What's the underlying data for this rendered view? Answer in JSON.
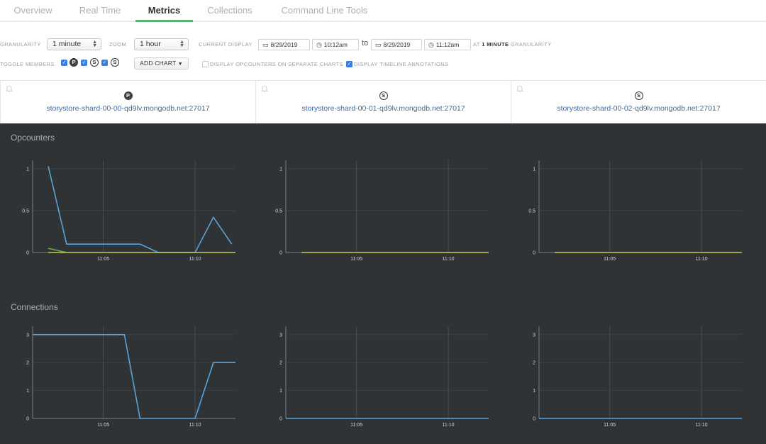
{
  "tabs": [
    {
      "label": "Overview",
      "active": false
    },
    {
      "label": "Real Time",
      "active": false
    },
    {
      "label": "Metrics",
      "active": true
    },
    {
      "label": "Collections",
      "active": false
    },
    {
      "label": "Command Line Tools",
      "active": false
    }
  ],
  "controls": {
    "granularity_label": "GRANULARITY",
    "granularity_value": "1 minute",
    "zoom_label": "ZOOM",
    "zoom_value": "1 hour",
    "current_display_label": "CURRENT DISPLAY",
    "start_date": "8/29/2019",
    "start_time": "10:12am",
    "to_label": "to",
    "end_date": "8/29/2019",
    "end_time": "11:12am",
    "at_label": "AT",
    "granularity_bold": "1 MINUTE",
    "granularity_suffix": "GRANULARITY",
    "toggle_members_label": "TOGGLE MEMBERS",
    "members": [
      {
        "role": "P",
        "checked": true
      },
      {
        "role": "S",
        "checked": true
      },
      {
        "role": "S",
        "checked": true
      }
    ],
    "add_chart_label": "ADD CHART",
    "separate_charts_label": "DISPLAY OPCOUNTERS ON SEPARATE CHARTS",
    "separate_charts_checked": false,
    "timeline_annotations_label": "DISPLAY TIMELINE ANNOTATIONS",
    "timeline_annotations_checked": true
  },
  "hosts": [
    {
      "role": "P",
      "name": "storystore-shard-00-00-qd9lv.mongodb.net:27017"
    },
    {
      "role": "S",
      "name": "storystore-shard-00-01-qd9lv.mongodb.net:27017"
    },
    {
      "role": "S",
      "name": "storystore-shard-00-02-qd9lv.mongodb.net:27017"
    }
  ],
  "colors": {
    "series_blue": "#5ba3d9",
    "series_green": "#6ab04c",
    "series_yellow": "#c5c94a",
    "accent_tab": "#5aae6c",
    "link": "#3a6da6"
  },
  "chart_data": [
    {
      "section": "Opcounters",
      "type": "line",
      "host": "storystore-shard-00-00-qd9lv.mongodb.net:27017",
      "xlim": [
        1.15,
        12.2
      ],
      "ylim": [
        0,
        1.1
      ],
      "xticks": [
        {
          "v": 5,
          "label": "11:05"
        },
        {
          "v": 10,
          "label": "11:10"
        }
      ],
      "yticks": [
        {
          "v": 0,
          "label": "0"
        },
        {
          "v": 0.5,
          "label": "0.5"
        },
        {
          "v": 1,
          "label": "1"
        }
      ],
      "series": [
        {
          "name": "opcounter-blue",
          "color": "#5ba3d9",
          "x": [
            2,
            3,
            4,
            5,
            6,
            7,
            8,
            9,
            10,
            11,
            12
          ],
          "values": [
            1.03,
            0.1,
            0.1,
            0.1,
            0.1,
            0.1,
            0,
            0,
            0,
            0.42,
            0.1
          ]
        },
        {
          "name": "opcounter-green",
          "color": "#6ab04c",
          "x": [
            2,
            3
          ],
          "values": [
            0.05,
            0
          ]
        },
        {
          "name": "opcounter-yellow",
          "color": "#c5c94a",
          "x": [
            2,
            12.2
          ],
          "values": [
            0,
            0
          ]
        }
      ]
    },
    {
      "section": "Opcounters",
      "type": "line",
      "host": "storystore-shard-00-01-qd9lv.mongodb.net:27017",
      "xlim": [
        1.15,
        12.2
      ],
      "ylim": [
        0,
        1.1
      ],
      "xticks": [
        {
          "v": 5,
          "label": "11:05"
        },
        {
          "v": 10,
          "label": "11:10"
        }
      ],
      "yticks": [
        {
          "v": 0,
          "label": "0"
        },
        {
          "v": 0.5,
          "label": "0.5"
        },
        {
          "v": 1,
          "label": "1"
        }
      ],
      "series": [
        {
          "name": "opcounter-yellow",
          "color": "#c5c94a",
          "x": [
            2,
            12.2
          ],
          "values": [
            0,
            0
          ]
        }
      ]
    },
    {
      "section": "Opcounters",
      "type": "line",
      "host": "storystore-shard-00-02-qd9lv.mongodb.net:27017",
      "xlim": [
        1.15,
        12.2
      ],
      "ylim": [
        0,
        1.1
      ],
      "xticks": [
        {
          "v": 5,
          "label": "11:05"
        },
        {
          "v": 10,
          "label": "11:10"
        }
      ],
      "yticks": [
        {
          "v": 0,
          "label": "0"
        },
        {
          "v": 0.5,
          "label": "0.5"
        },
        {
          "v": 1,
          "label": "1"
        }
      ],
      "series": [
        {
          "name": "opcounter-yellow",
          "color": "#c5c94a",
          "x": [
            2,
            12.2
          ],
          "values": [
            0,
            0
          ]
        }
      ]
    },
    {
      "section": "Connections",
      "type": "line",
      "host": "storystore-shard-00-00-qd9lv.mongodb.net:27017",
      "xlim": [
        1.15,
        12.2
      ],
      "ylim": [
        0,
        3.3
      ],
      "xticks": [
        {
          "v": 5,
          "label": "11:05"
        },
        {
          "v": 10,
          "label": "11:10"
        }
      ],
      "yticks": [
        {
          "v": 0,
          "label": "0"
        },
        {
          "v": 1,
          "label": "1"
        },
        {
          "v": 2,
          "label": "2"
        },
        {
          "v": 3,
          "label": "3"
        }
      ],
      "series": [
        {
          "name": "connections",
          "color": "#5ba3d9",
          "x": [
            1.15,
            2,
            3,
            4,
            5,
            6.15,
            7,
            8,
            9,
            10,
            11,
            12.2
          ],
          "values": [
            3,
            3,
            3,
            3,
            3,
            3,
            0,
            0,
            0,
            0,
            2,
            2
          ]
        }
      ]
    },
    {
      "section": "Connections",
      "type": "line",
      "host": "storystore-shard-00-01-qd9lv.mongodb.net:27017",
      "xlim": [
        1.15,
        12.2
      ],
      "ylim": [
        0,
        3.3
      ],
      "xticks": [
        {
          "v": 5,
          "label": "11:05"
        },
        {
          "v": 10,
          "label": "11:10"
        }
      ],
      "yticks": [
        {
          "v": 0,
          "label": "0"
        },
        {
          "v": 1,
          "label": "1"
        },
        {
          "v": 2,
          "label": "2"
        },
        {
          "v": 3,
          "label": "3"
        }
      ],
      "series": [
        {
          "name": "connections",
          "color": "#5ba3d9",
          "x": [
            1.15,
            12.2
          ],
          "values": [
            0,
            0
          ]
        }
      ]
    },
    {
      "section": "Connections",
      "type": "line",
      "host": "storystore-shard-00-02-qd9lv.mongodb.net:27017",
      "xlim": [
        1.15,
        12.2
      ],
      "ylim": [
        0,
        3.3
      ],
      "xticks": [
        {
          "v": 5,
          "label": "11:05"
        },
        {
          "v": 10,
          "label": "11:10"
        }
      ],
      "yticks": [
        {
          "v": 0,
          "label": "0"
        },
        {
          "v": 1,
          "label": "1"
        },
        {
          "v": 2,
          "label": "2"
        },
        {
          "v": 3,
          "label": "3"
        }
      ],
      "series": [
        {
          "name": "connections",
          "color": "#5ba3d9",
          "x": [
            1.15,
            12.2
          ],
          "values": [
            0,
            0
          ]
        }
      ]
    }
  ],
  "sections": {
    "opcounters_title": "Opcounters",
    "connections_title": "Connections"
  }
}
